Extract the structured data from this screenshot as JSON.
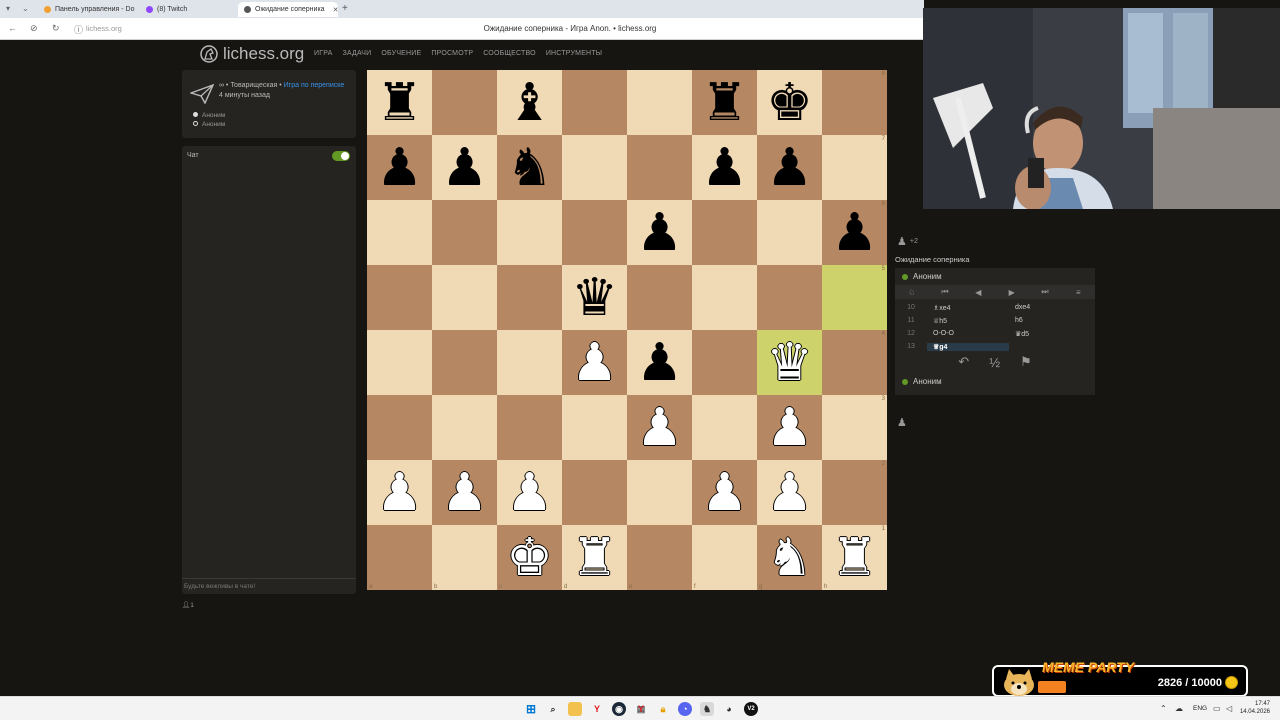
{
  "browser": {
    "tabs": [
      {
        "label": "Панель управления - Do",
        "fav_color": "#f0a030"
      },
      {
        "label": "(8) Twitch",
        "fav_color": "#9146ff"
      },
      {
        "label": "Ожидание соперника",
        "fav_color": "#555555"
      }
    ],
    "url": "lichess.org",
    "page_title": "Ожидание соперника - Игра Anon. • lichess.org"
  },
  "header": {
    "logo_text": "lichess.org",
    "nav": [
      "ИГРА",
      "ЗАДАЧИ",
      "ОБУЧЕНИЕ",
      "ПРОСМОТР",
      "СООБЩЕСТВО",
      "ИНСТРУМЕНТЫ"
    ]
  },
  "game_info": {
    "mode": "∞ • Товарищеская •",
    "type_link": "Игра по переписке",
    "time_ago": "4 минуты назад",
    "player1": "Аноним",
    "player2": "Аноним"
  },
  "chat": {
    "title": "Чат",
    "placeholder": "Будьте вежливы в чате!",
    "spectators": "1"
  },
  "board": {
    "files": [
      "a",
      "b",
      "c",
      "d",
      "e",
      "f",
      "g",
      "h"
    ],
    "ranks": [
      "8",
      "7",
      "6",
      "5",
      "4",
      "3",
      "2",
      "1"
    ],
    "highlight": [
      "h5",
      "g4"
    ],
    "pieces": {
      "a8": "♜b",
      "c8": "♝b",
      "f8": "♜b",
      "g8": "♚b",
      "a7": "♟b",
      "b7": "♟b",
      "c7": "♞b",
      "f7": "♟b",
      "g7": "♟b",
      "e6": "♟b",
      "h6": "♟b",
      "d5": "♛b",
      "d4": "♟w",
      "e4": "♟b",
      "g4": "♛w",
      "e3": "♟w",
      "g3": "♟w",
      "a2": "♟w",
      "b2": "♟w",
      "c2": "♟w",
      "f2": "♟w",
      "g2": "♟w",
      "c1": "♚w",
      "d1": "♜w",
      "g1": "♞w",
      "h1": "♜w"
    }
  },
  "right_panel": {
    "material": "+2",
    "status": "Ожидание соперника",
    "top_player": "Аноним",
    "bottom_player": "Аноним",
    "moves": [
      {
        "num": "10",
        "white": "♗xe4",
        "black": "dxe4"
      },
      {
        "num": "11",
        "white": "♕h5",
        "black": "h6"
      },
      {
        "num": "12",
        "white": "O-O-O",
        "black": "♛d5"
      },
      {
        "num": "13",
        "white": "♕g4",
        "black": ""
      }
    ],
    "controls": [
      "♘",
      "⏮",
      "◀",
      "▶",
      "⏭",
      "≡"
    ],
    "actions": [
      "↶",
      "½",
      "⚑"
    ]
  },
  "overlay": {
    "title": "MEME PARTY",
    "count": "2826 / 10000"
  },
  "taskbar": {
    "lang": "ENG",
    "time": "17:47",
    "date": "14.04.2026"
  }
}
